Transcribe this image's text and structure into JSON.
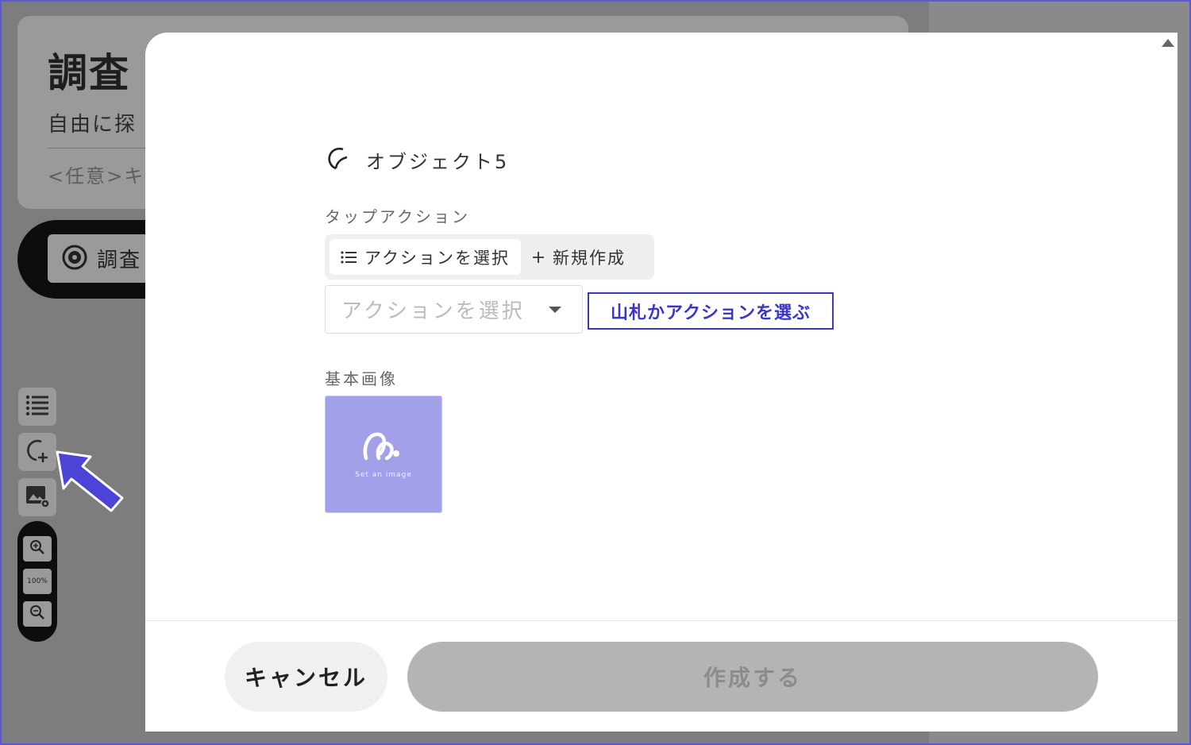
{
  "background": {
    "page_title": "調査",
    "subtitle": "自由に探",
    "hint": "<任意>キ",
    "chip_label": "調査",
    "zoom_label": "100%"
  },
  "modal": {
    "object_name": "オブジェクト5",
    "tap_action_label": "タップアクション",
    "segments": {
      "select_action": "アクションを選択",
      "create_new": "新規作成"
    },
    "action_select": {
      "placeholder": "アクションを選択"
    },
    "annotation": "山札かアクションを選ぶ",
    "base_image_label": "基本画像",
    "image_placeholder_caption": "Set an image",
    "cancel_button": "キャンセル",
    "create_button": "作成する"
  },
  "colors": {
    "annotation": "#3b36c9",
    "thumbnail": "#a3a0ea",
    "arrow": "#4b44d6"
  }
}
